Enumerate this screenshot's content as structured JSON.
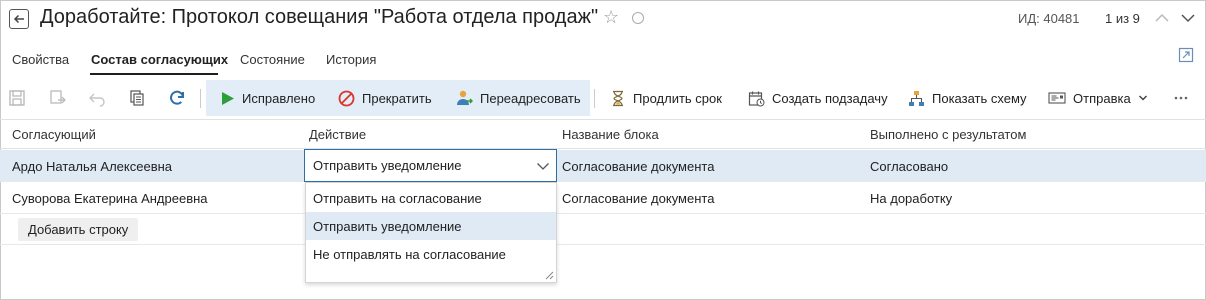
{
  "header": {
    "title": "Доработайте: Протокол совещания \"Работа отдела продаж\"",
    "doc_id": "ИД: 40481",
    "pager": "1 из 9"
  },
  "tabs": [
    {
      "label": "Свойства"
    },
    {
      "label": "Состав согласующих"
    },
    {
      "label": "Состояние"
    },
    {
      "label": "История"
    }
  ],
  "toolbar": {
    "fixed_label": "Исправлено",
    "stop_label": "Прекратить",
    "redirect_label": "Переадресовать",
    "extend_label": "Продлить срок",
    "subtask_label": "Создать подзадачу",
    "scheme_label": "Показать схему",
    "send_label": "Отправка"
  },
  "table": {
    "columns": [
      "Согласующий",
      "Действие",
      "Название блока",
      "Выполнено с результатом"
    ],
    "rows": [
      {
        "approver": "Ардо Наталья Алексеевна",
        "action": "Отправить уведомление",
        "block": "Согласование документа",
        "result": "Согласовано"
      },
      {
        "approver": "Суворова Екатерина Андреевна",
        "action": "",
        "block": "Согласование документа",
        "result": "На доработку"
      }
    ],
    "add_row_label": "Добавить строку"
  },
  "dropdown": {
    "options": [
      "Отправить на согласование",
      "Отправить уведомление",
      "Не отправлять на согласование"
    ],
    "highlighted_index": 1
  },
  "colors": {
    "accent": "#2f6fa8",
    "selection": "#dfeaf5",
    "play_green": "#2e9d3a",
    "stop_red": "#d9352b"
  }
}
